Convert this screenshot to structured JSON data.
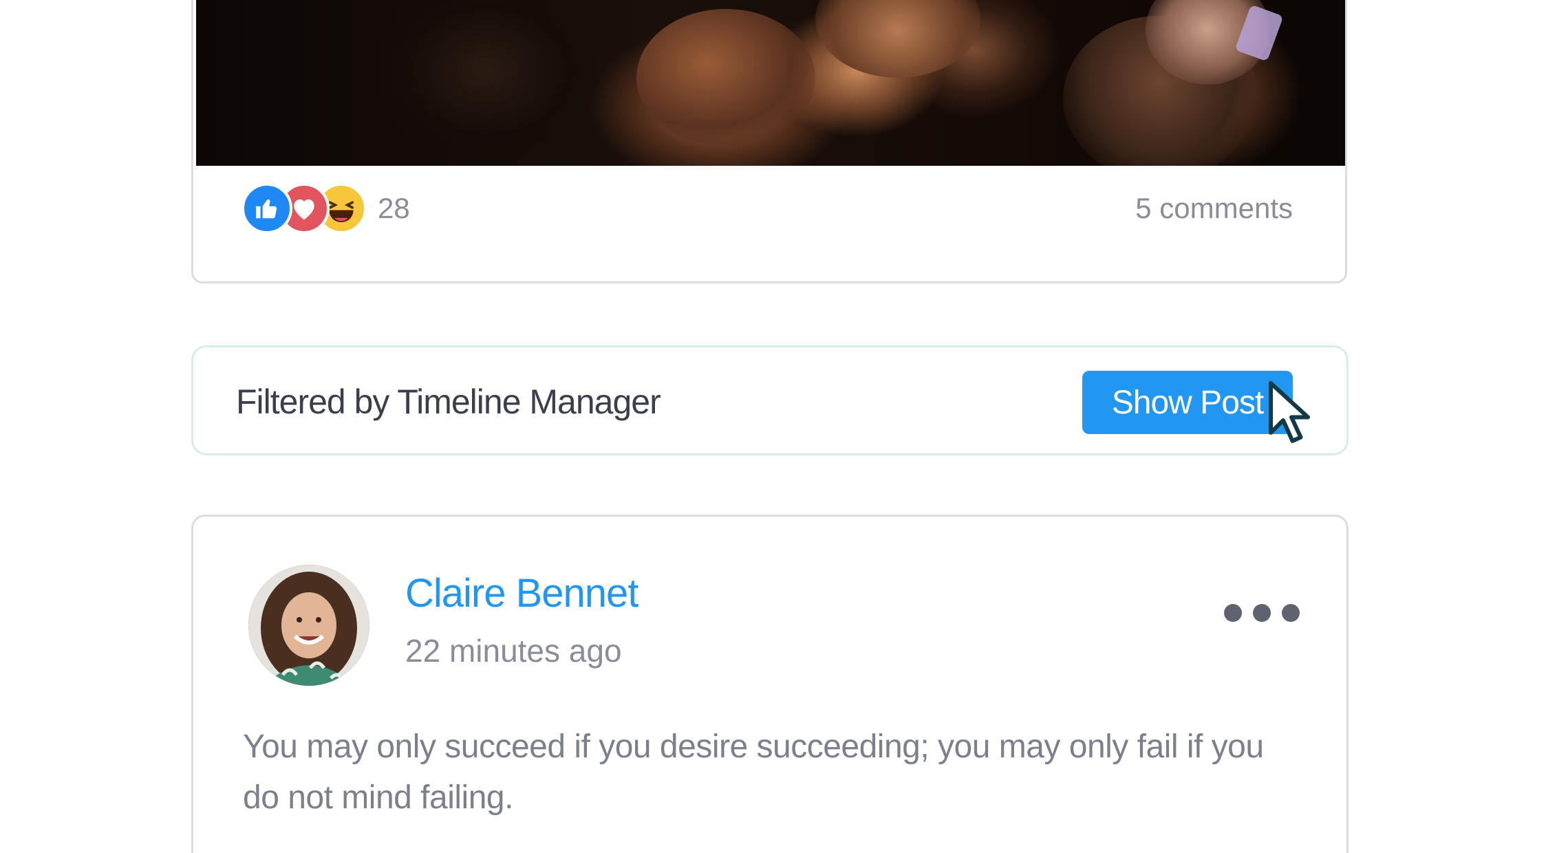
{
  "previous_post": {
    "reaction_icons": [
      "like-icon",
      "love-icon",
      "haha-icon"
    ],
    "reaction_count": "28",
    "comments_label": "5 comments"
  },
  "filter_notice": {
    "text": "Filtered by Timeline Manager",
    "button_label": "Show Post"
  },
  "post": {
    "author": "Claire Bennet",
    "time": "22 minutes ago",
    "body": "You may only succeed if you desire succeeding; you may only fail if you do not mind failing."
  },
  "colors": {
    "accent": "#2196f3",
    "like": "#1e88f5",
    "love": "#e2555f",
    "haha": "#f7c63b",
    "muted_text": "#8a8d99"
  }
}
